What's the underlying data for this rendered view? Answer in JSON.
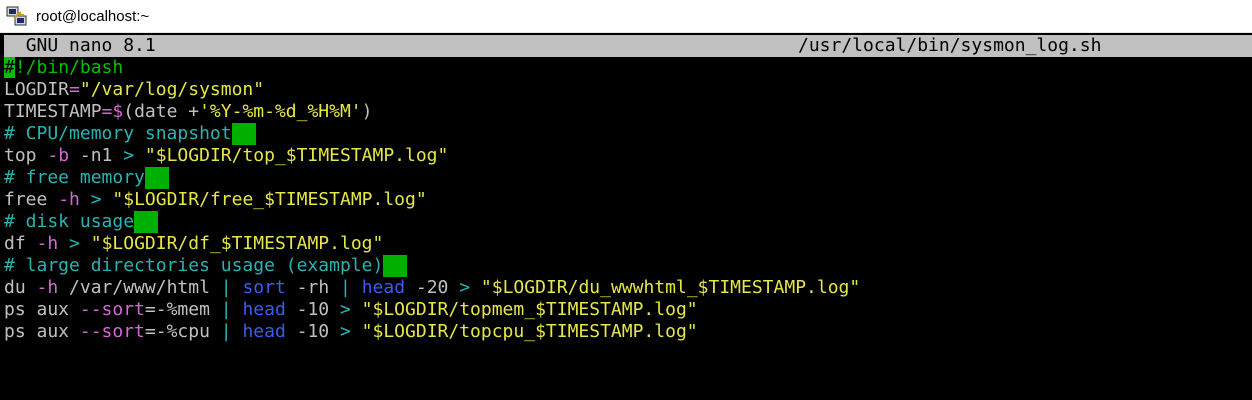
{
  "window": {
    "title": "root@localhost:~",
    "icon": "putty-icon"
  },
  "nano": {
    "version_label": "GNU nano 8.1",
    "file_path": "/usr/local/bin/sysmon_log.sh"
  },
  "colors": {
    "comment": "#2ab3b3",
    "string": "#e6e64a",
    "flag": "#d26ad2",
    "keyword": "#3a5cf0",
    "cursor": "#00c000",
    "header_bg": "#c0c0c0"
  },
  "lines": [
    [
      {
        "t": "#",
        "c": "cursor"
      },
      {
        "t": "!/bin/bash",
        "c": "c-shebang"
      }
    ],
    [
      {
        "t": "LOGDIR",
        "c": ""
      },
      {
        "t": "=",
        "c": "c-sub"
      },
      {
        "t": "\"/var/log/sysmon\"",
        "c": "c-str"
      }
    ],
    [
      {
        "t": "TIMESTAMP",
        "c": ""
      },
      {
        "t": "=$",
        "c": "c-sub"
      },
      {
        "t": "(date +",
        "c": ""
      },
      {
        "t": "'%Y-%m-%d_%H%M'",
        "c": "c-str"
      },
      {
        "t": ")",
        "c": ""
      }
    ],
    [
      {
        "t": "# CPU/memory snapshot",
        "c": "c-comment"
      },
      {
        "t": "",
        "c": "trail"
      }
    ],
    [
      {
        "t": "top ",
        "c": ""
      },
      {
        "t": "-b",
        "c": "c-flag"
      },
      {
        "t": " -n1 ",
        "c": ""
      },
      {
        "t": ">",
        "c": "c-op"
      },
      {
        "t": " ",
        "c": ""
      },
      {
        "t": "\"$LOGDIR/top_$TIMESTAMP.log\"",
        "c": "c-str"
      }
    ],
    [
      {
        "t": "# free memory",
        "c": "c-comment"
      },
      {
        "t": "",
        "c": "trail"
      }
    ],
    [
      {
        "t": "free ",
        "c": ""
      },
      {
        "t": "-h",
        "c": "c-flag"
      },
      {
        "t": " ",
        "c": ""
      },
      {
        "t": ">",
        "c": "c-op"
      },
      {
        "t": " ",
        "c": ""
      },
      {
        "t": "\"$LOGDIR/free_$TIMESTAMP.log\"",
        "c": "c-str"
      }
    ],
    [
      {
        "t": "# disk usage",
        "c": "c-comment"
      },
      {
        "t": "",
        "c": "trail"
      }
    ],
    [
      {
        "t": "df ",
        "c": ""
      },
      {
        "t": "-h",
        "c": "c-flag"
      },
      {
        "t": " ",
        "c": ""
      },
      {
        "t": ">",
        "c": "c-op"
      },
      {
        "t": " ",
        "c": ""
      },
      {
        "t": "\"$LOGDIR/df_$TIMESTAMP.log\"",
        "c": "c-str"
      }
    ],
    [
      {
        "t": "# large directories usage (example)",
        "c": "c-comment"
      },
      {
        "t": "",
        "c": "trail"
      }
    ],
    [
      {
        "t": "du ",
        "c": ""
      },
      {
        "t": "-h",
        "c": "c-flag"
      },
      {
        "t": " /var/www/html ",
        "c": ""
      },
      {
        "t": "|",
        "c": "c-op"
      },
      {
        "t": " ",
        "c": ""
      },
      {
        "t": "sort",
        "c": "c-keyword"
      },
      {
        "t": " -rh ",
        "c": ""
      },
      {
        "t": "|",
        "c": "c-op"
      },
      {
        "t": " ",
        "c": ""
      },
      {
        "t": "head",
        "c": "c-keyword"
      },
      {
        "t": " -20 ",
        "c": ""
      },
      {
        "t": ">",
        "c": "c-op"
      },
      {
        "t": " ",
        "c": ""
      },
      {
        "t": "\"$LOGDIR/du_wwwhtml_$TIMESTAMP.log\"",
        "c": "c-str"
      }
    ],
    [
      {
        "t": "ps aux ",
        "c": ""
      },
      {
        "t": "--sort",
        "c": "c-flag"
      },
      {
        "t": "=-%mem ",
        "c": ""
      },
      {
        "t": "|",
        "c": "c-op"
      },
      {
        "t": " ",
        "c": ""
      },
      {
        "t": "head",
        "c": "c-keyword"
      },
      {
        "t": " -10 ",
        "c": ""
      },
      {
        "t": ">",
        "c": "c-op"
      },
      {
        "t": " ",
        "c": ""
      },
      {
        "t": "\"$LOGDIR/topmem_$TIMESTAMP.log\"",
        "c": "c-str"
      }
    ],
    [
      {
        "t": "ps aux ",
        "c": ""
      },
      {
        "t": "--sort",
        "c": "c-flag"
      },
      {
        "t": "=-%cpu ",
        "c": ""
      },
      {
        "t": "|",
        "c": "c-op"
      },
      {
        "t": " ",
        "c": ""
      },
      {
        "t": "head",
        "c": "c-keyword"
      },
      {
        "t": " -10 ",
        "c": ""
      },
      {
        "t": ">",
        "c": "c-op"
      },
      {
        "t": " ",
        "c": ""
      },
      {
        "t": "\"$LOGDIR/topcpu_$TIMESTAMP.log\"",
        "c": "c-str"
      }
    ]
  ]
}
